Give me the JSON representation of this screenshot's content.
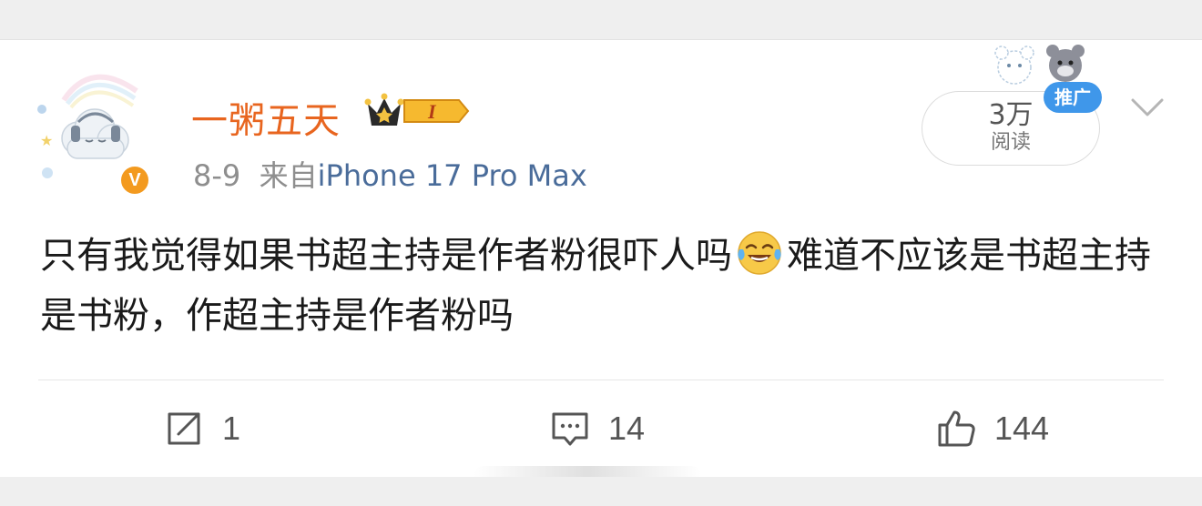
{
  "user": {
    "name": "一粥五天",
    "vip_level": "I",
    "verified_mark": "V"
  },
  "post": {
    "date": "8-9",
    "source_prefix": "来自",
    "source": "iPhone 17 Pro Max",
    "text_part1": "只有我觉得如果书超主持是作者粉很吓人吗",
    "emoji": "laughing-tears-emoji",
    "text_part2": "难道不应该是书超主持是书粉，作超主持是作者粉吗"
  },
  "stats": {
    "reads_count": "3万",
    "reads_label": "阅读",
    "promo_label": "推广"
  },
  "actions": {
    "repost_count": "1",
    "comment_count": "14",
    "like_count": "144"
  },
  "colors": {
    "username": "#e8651f",
    "source": "#4a6c9a",
    "promo": "#3f97ea",
    "verified": "#f39a1f"
  },
  "icons": [
    "cloud-avatar",
    "crown-icon",
    "chevron-down-icon",
    "repost-icon",
    "comment-icon",
    "like-icon"
  ]
}
